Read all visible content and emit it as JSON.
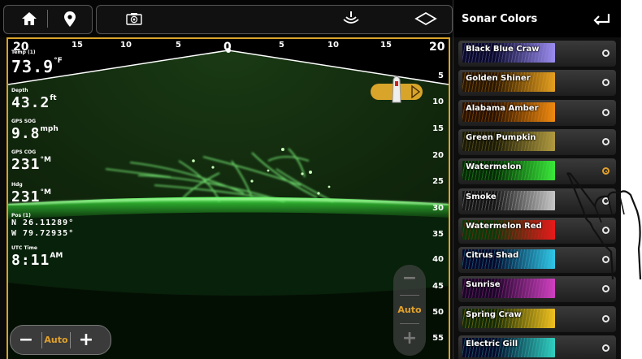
{
  "topbar": {
    "home_icon": "home-icon",
    "waypoint_icon": "waypoint-pin-icon",
    "camera_icon": "sonar-camera-icon",
    "sonar_icon": "sonar-waves-icon",
    "structure_icon": "chart-diamond-icon"
  },
  "sonar": {
    "x_scale": [
      "20",
      "15",
      "10",
      "5",
      "0",
      "5",
      "10",
      "15",
      "20"
    ],
    "depth_scale": [
      "5",
      "10",
      "15",
      "20",
      "25",
      "30",
      "35",
      "40",
      "45",
      "50",
      "55"
    ],
    "readouts": {
      "temp_label": "Temp (1)",
      "temp_value": "73.9",
      "temp_unit": "°F",
      "depth_label": "Depth",
      "depth_value": "43.2",
      "depth_unit": "ft",
      "sog_label": "GPS SOG",
      "sog_value": "9.8",
      "sog_unit": "mph",
      "cog_label": "GPS COG",
      "cog_value": "231",
      "cog_unit": "°M",
      "hdg_label": "Hdg",
      "hdg_value": "231",
      "hdg_unit": "°M",
      "pos_label": "Pos (1)",
      "pos_lat": "N 26.11289°",
      "pos_lon": "W 79.72935°",
      "time_label": "UTC Time",
      "time_value": "8:11",
      "time_unit": "AM"
    },
    "zoom": {
      "minus": "−",
      "label": "Auto",
      "plus": "+"
    },
    "range": {
      "minus": "−",
      "label": "Auto",
      "plus": "+"
    }
  },
  "panel": {
    "title": "Sonar Colors",
    "back_icon": "back-arrow-icon",
    "palettes": [
      {
        "name": "Black Blue Craw",
        "selected": false,
        "c1": "#0a0a2a",
        "c2": "#9a8cf0"
      },
      {
        "name": "Golden Shiner",
        "selected": false,
        "c1": "#2a1600",
        "c2": "#e6a020"
      },
      {
        "name": "Alabama Amber",
        "selected": false,
        "c1": "#2a1200",
        "c2": "#f08a10"
      },
      {
        "name": "Green Pumpkin",
        "selected": false,
        "c1": "#1a1a06",
        "c2": "#b09a40"
      },
      {
        "name": "Watermelon",
        "selected": true,
        "c1": "#062a06",
        "c2": "#3ae83a"
      },
      {
        "name": "Smoke",
        "selected": false,
        "c1": "#151515",
        "c2": "#c8c8c8"
      },
      {
        "name": "Watermelon Red",
        "selected": false,
        "c1": "#0a3a0a",
        "c2": "#e81a1a"
      },
      {
        "name": "Citrus Shad",
        "selected": false,
        "c1": "#06082a",
        "c2": "#30c8e8"
      },
      {
        "name": "Sunrise",
        "selected": false,
        "c1": "#1a0626",
        "c2": "#d040c0"
      },
      {
        "name": "Spring Craw",
        "selected": false,
        "c1": "#122a06",
        "c2": "#f0c020"
      },
      {
        "name": "Electric Gill",
        "selected": false,
        "c1": "#06082a",
        "c2": "#30d0c0"
      }
    ]
  }
}
